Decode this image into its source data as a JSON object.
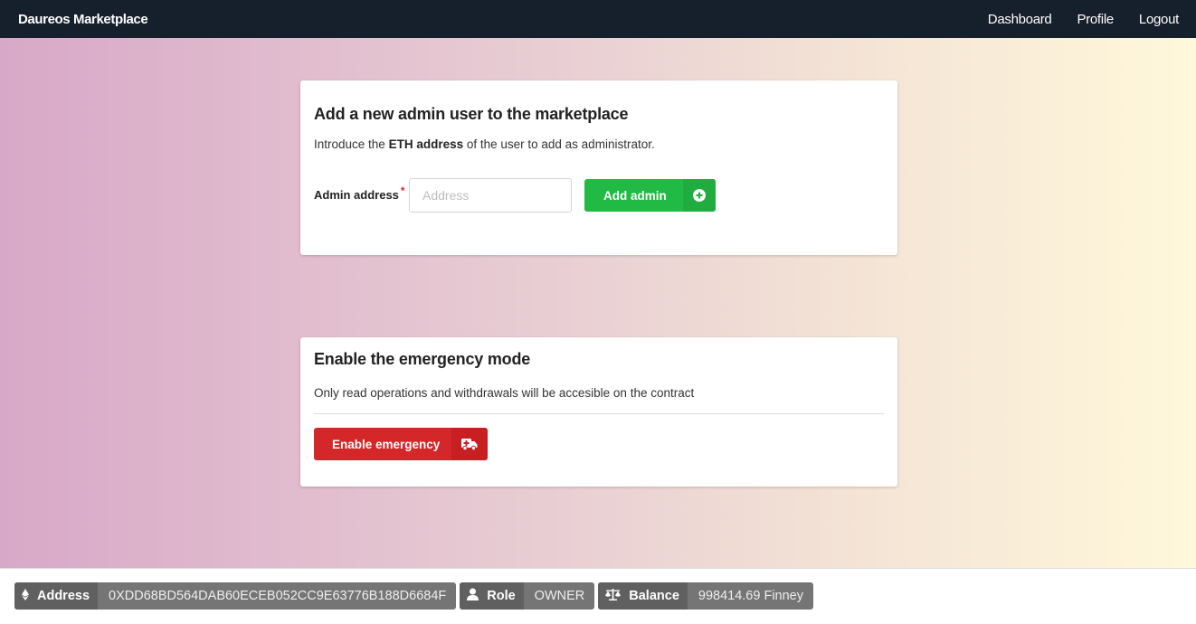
{
  "navbar": {
    "brand": "Daureos Marketplace",
    "links": [
      "Dashboard",
      "Profile",
      "Logout"
    ]
  },
  "admin_card": {
    "title": "Add a new admin user to the marketplace",
    "desc_prefix": "Introduce the ",
    "desc_bold": "ETH address",
    "desc_suffix": " of the user to add as administrator.",
    "field_label": "Admin address",
    "required_mark": "*",
    "input_value": "",
    "input_placeholder": "Address",
    "button_label": "Add admin",
    "button_icon": "plus-circle-icon",
    "button_color": "#21ba45"
  },
  "emergency_card": {
    "title": "Enable the emergency mode",
    "desc": "Only read operations and withdrawals will be accesible on the contract",
    "button_label": "Enable emergency",
    "button_icon": "ambulance-icon",
    "button_color": "#d32729"
  },
  "footer": {
    "address": {
      "icon": "ethereum-icon",
      "label": "Address",
      "value": "0XDD68BD564DAB60ECEB052CC9E63776B188D6684F"
    },
    "role": {
      "icon": "user-icon",
      "label": "Role",
      "value": "OWNER"
    },
    "balance": {
      "icon": "balance-scale-icon",
      "label": "Balance",
      "value": "998414.69 Finney"
    }
  }
}
